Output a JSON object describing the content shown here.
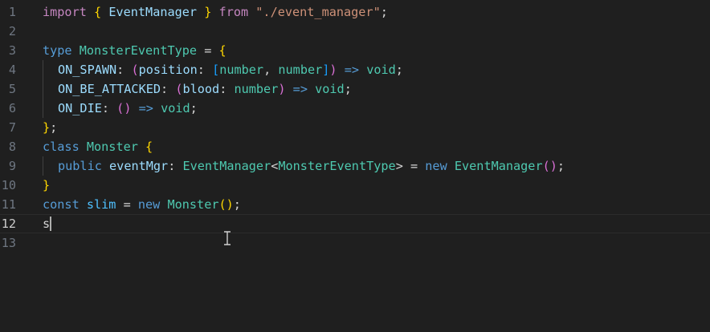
{
  "editor": {
    "current_line": 12,
    "lines": [
      {
        "n": "1",
        "indent": 0,
        "tokens": [
          [
            "import",
            "#c586c0"
          ],
          [
            " ",
            ""
          ],
          [
            "{",
            "#ffd700"
          ],
          [
            " ",
            ""
          ],
          [
            "EventManager",
            "#9cdcfe"
          ],
          [
            " ",
            ""
          ],
          [
            "}",
            "#ffd700"
          ],
          [
            " ",
            ""
          ],
          [
            "from",
            "#c586c0"
          ],
          [
            " ",
            ""
          ],
          [
            "\"./event_manager\"",
            "#ce9178"
          ],
          [
            ";",
            "#d4d4d4"
          ]
        ]
      },
      {
        "n": "2",
        "indent": 0,
        "tokens": []
      },
      {
        "n": "3",
        "indent": 0,
        "tokens": [
          [
            "type",
            "#569cd6"
          ],
          [
            " ",
            ""
          ],
          [
            "MonsterEventType",
            "#4ec9b0"
          ],
          [
            " = ",
            "#d4d4d4"
          ],
          [
            "{",
            "#ffd700"
          ]
        ]
      },
      {
        "n": "4",
        "indent": 1,
        "tokens": [
          [
            "ON_SPAWN",
            "#9cdcfe"
          ],
          [
            ": ",
            "#d4d4d4"
          ],
          [
            "(",
            "#da70d6"
          ],
          [
            "position",
            "#9cdcfe"
          ],
          [
            ": ",
            "#d4d4d4"
          ],
          [
            "[",
            "#179fff"
          ],
          [
            "number",
            "#4ec9b0"
          ],
          [
            ", ",
            "#d4d4d4"
          ],
          [
            "number",
            "#4ec9b0"
          ],
          [
            "]",
            "#179fff"
          ],
          [
            ")",
            "#da70d6"
          ],
          [
            " ",
            ""
          ],
          [
            "=>",
            "#569cd6"
          ],
          [
            " ",
            ""
          ],
          [
            "void",
            "#4ec9b0"
          ],
          [
            ";",
            "#d4d4d4"
          ]
        ]
      },
      {
        "n": "5",
        "indent": 1,
        "tokens": [
          [
            "ON_BE_ATTACKED",
            "#9cdcfe"
          ],
          [
            ": ",
            "#d4d4d4"
          ],
          [
            "(",
            "#da70d6"
          ],
          [
            "blood",
            "#9cdcfe"
          ],
          [
            ": ",
            "#d4d4d4"
          ],
          [
            "number",
            "#4ec9b0"
          ],
          [
            ")",
            "#da70d6"
          ],
          [
            " ",
            ""
          ],
          [
            "=>",
            "#569cd6"
          ],
          [
            " ",
            ""
          ],
          [
            "void",
            "#4ec9b0"
          ],
          [
            ";",
            "#d4d4d4"
          ]
        ]
      },
      {
        "n": "6",
        "indent": 1,
        "tokens": [
          [
            "ON_DIE",
            "#9cdcfe"
          ],
          [
            ": ",
            "#d4d4d4"
          ],
          [
            "()",
            "#da70d6"
          ],
          [
            " ",
            ""
          ],
          [
            "=>",
            "#569cd6"
          ],
          [
            " ",
            ""
          ],
          [
            "void",
            "#4ec9b0"
          ],
          [
            ";",
            "#d4d4d4"
          ]
        ]
      },
      {
        "n": "7",
        "indent": 0,
        "tokens": [
          [
            "}",
            "#ffd700"
          ],
          [
            ";",
            "#d4d4d4"
          ]
        ]
      },
      {
        "n": "8",
        "indent": 0,
        "tokens": [
          [
            "class",
            "#569cd6"
          ],
          [
            " ",
            ""
          ],
          [
            "Monster",
            "#4ec9b0"
          ],
          [
            " ",
            ""
          ],
          [
            "{",
            "#ffd700"
          ]
        ]
      },
      {
        "n": "9",
        "indent": 1,
        "tokens": [
          [
            "public",
            "#569cd6"
          ],
          [
            " ",
            ""
          ],
          [
            "eventMgr",
            "#9cdcfe"
          ],
          [
            ": ",
            "#d4d4d4"
          ],
          [
            "EventManager",
            "#4ec9b0"
          ],
          [
            "<",
            "#d4d4d4"
          ],
          [
            "MonsterEventType",
            "#4ec9b0"
          ],
          [
            ">",
            "#d4d4d4"
          ],
          [
            " = ",
            "#d4d4d4"
          ],
          [
            "new",
            "#569cd6"
          ],
          [
            " ",
            ""
          ],
          [
            "EventManager",
            "#4ec9b0"
          ],
          [
            "()",
            "#da70d6"
          ],
          [
            ";",
            "#d4d4d4"
          ]
        ]
      },
      {
        "n": "10",
        "indent": 0,
        "tokens": [
          [
            "}",
            "#ffd700"
          ]
        ]
      },
      {
        "n": "11",
        "indent": 0,
        "tokens": [
          [
            "const",
            "#569cd6"
          ],
          [
            " ",
            ""
          ],
          [
            "slim",
            "#4fc1ff"
          ],
          [
            " = ",
            "#d4d4d4"
          ],
          [
            "new",
            "#569cd6"
          ],
          [
            " ",
            ""
          ],
          [
            "Monster",
            "#4ec9b0"
          ],
          [
            "()",
            "#ffd700"
          ],
          [
            ";",
            "#d4d4d4"
          ]
        ]
      },
      {
        "n": "12",
        "indent": 0,
        "tokens": [
          [
            "s",
            "#d4d4d4"
          ]
        ]
      },
      {
        "n": "13",
        "indent": 0,
        "tokens": []
      }
    ]
  }
}
